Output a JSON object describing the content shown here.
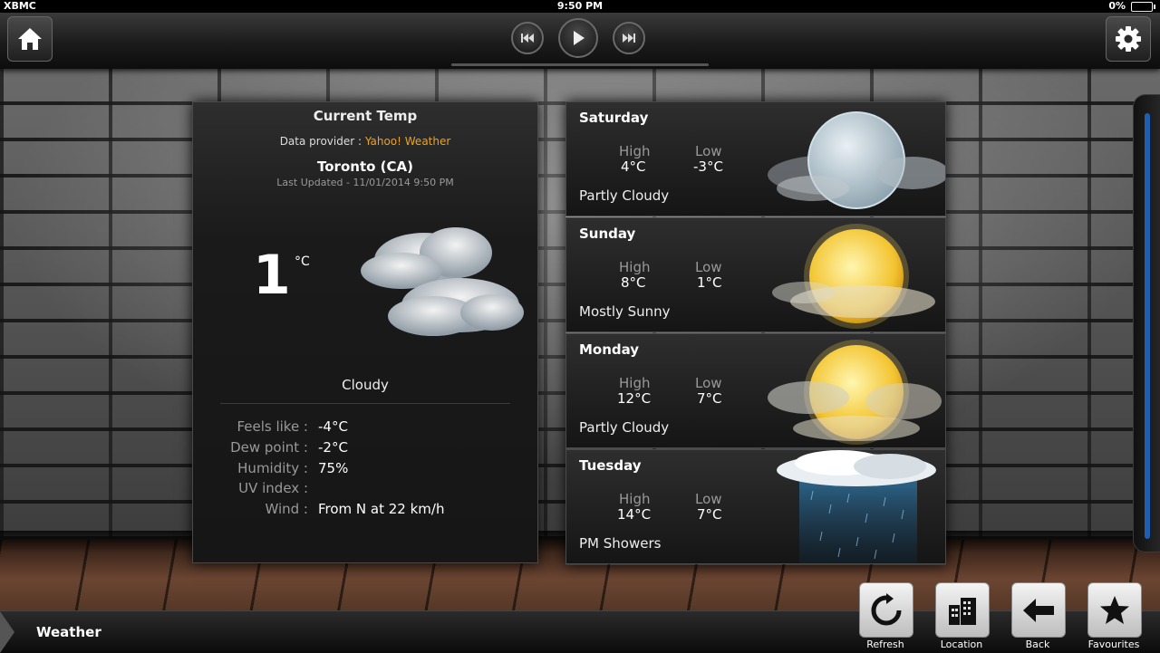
{
  "status_bar": {
    "app_name": "XBMC",
    "time": "9:50 PM",
    "battery": "0%"
  },
  "icons": {
    "home": "home-icon",
    "settings": "gear-icon",
    "prev": "skip-previous-icon",
    "play": "play-icon",
    "next": "skip-next-icon",
    "refresh": "refresh-icon",
    "location": "building-icon",
    "back": "arrow-left-icon",
    "favourites": "star-icon"
  },
  "current": {
    "title": "Current Temp",
    "provider_label": "Data provider : ",
    "provider_name": "Yahoo! Weather",
    "city": "Toronto  (CA)",
    "last_updated": "Last Updated - 11/01/2014 9:50 PM",
    "temperature": "1",
    "unit": "°C",
    "condition": "Cloudy",
    "details": [
      {
        "label": "Feels like :",
        "value": "-4°C"
      },
      {
        "label": "Dew point :",
        "value": "-2°C"
      },
      {
        "label": "Humidity :",
        "value": "75%"
      },
      {
        "label": "UV index :",
        "value": ""
      },
      {
        "label": "Wind :",
        "value": "From N at 22 km/h"
      }
    ]
  },
  "forecast": [
    {
      "day": "Saturday",
      "high_label": "High",
      "low_label": "Low",
      "high": "4°C",
      "low": "-3°C",
      "condition": "Partly Cloudy",
      "icon": "moon-cloud-icon"
    },
    {
      "day": "Sunday",
      "high_label": "High",
      "low_label": "Low",
      "high": "8°C",
      "low": "1°C",
      "condition": "Mostly Sunny",
      "icon": "sun-cloud-icon"
    },
    {
      "day": "Monday",
      "high_label": "High",
      "low_label": "Low",
      "high": "12°C",
      "low": "7°C",
      "condition": "Partly Cloudy",
      "icon": "sun-cloud-icon"
    },
    {
      "day": "Tuesday",
      "high_label": "High",
      "low_label": "Low",
      "high": "14°C",
      "low": "7°C",
      "condition": "PM Showers",
      "icon": "rain-cloud-icon"
    }
  ],
  "bottom_bar": {
    "screen_title": "Weather",
    "actions": [
      {
        "label": "Refresh"
      },
      {
        "label": "Location"
      },
      {
        "label": "Back"
      },
      {
        "label": "Favourites"
      }
    ]
  },
  "colors": {
    "accent": "#f0a21c",
    "scroll": "#1f5fb3"
  }
}
